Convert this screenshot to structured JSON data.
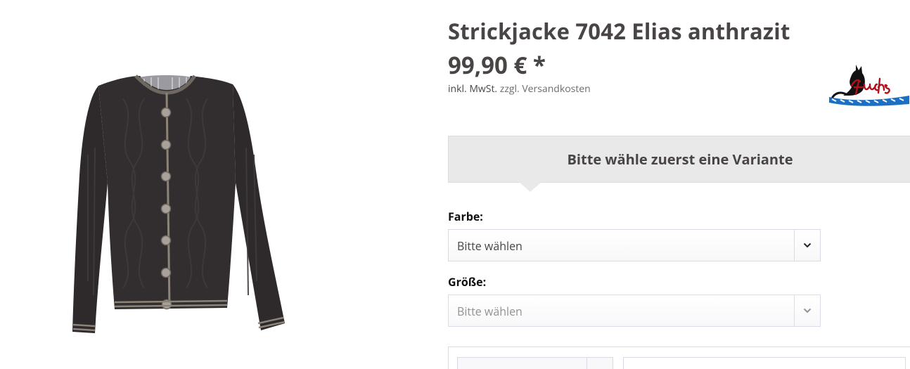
{
  "product": {
    "title": "Strickjacke 7042 Elias anthrazit",
    "price": "99,90 € *",
    "tax_prefix": "inkl. MwSt.",
    "shipping_link": "zzgl. Versandkosten",
    "image_icon": "knit-cardigan-image",
    "brand_logo_icon": "fuchs-trachtenmoden-logo"
  },
  "variant": {
    "hint": "Bitte wähle zuerst eine Variante"
  },
  "options": [
    {
      "label": "Farbe:",
      "value": "Bitte wählen",
      "state": "enabled"
    },
    {
      "label": "Größe:",
      "value": "Bitte wählen",
      "state": "disabled"
    }
  ],
  "colors": {
    "text": "#4a4545",
    "hint_bg": "#e9e9e9",
    "border": "#dadae5",
    "garment": "#2e2a2b",
    "trim": "#8c8577"
  }
}
